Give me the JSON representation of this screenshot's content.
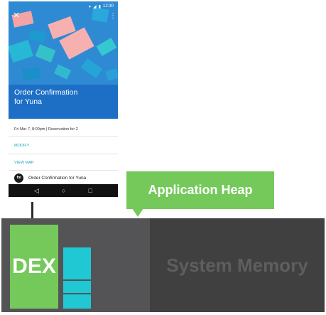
{
  "phone": {
    "status_time": "12:30",
    "close_icon": "close-icon",
    "more_icon": "more-vert-icon",
    "title_line1": "Order Confirmation",
    "title_line2": "for Yuna",
    "date_line": "Fri Mar 7, 8:00pm | Reservation for 2",
    "modify_label": "MODIFY",
    "view_map_label": "VIEW MAP",
    "avatar_text": "fm",
    "inbox_item": "Order Confirmation for Yuna",
    "nav": {
      "back": "◁",
      "home": "○",
      "recents": "□"
    }
  },
  "diagram": {
    "callout_label": "Application Heap",
    "dex_label": "DEX",
    "system_label": "System Memory"
  },
  "colors": {
    "green": "#74c95a",
    "cyan": "#20c8d4",
    "app_region": "#545456",
    "system_region": "#404040"
  }
}
